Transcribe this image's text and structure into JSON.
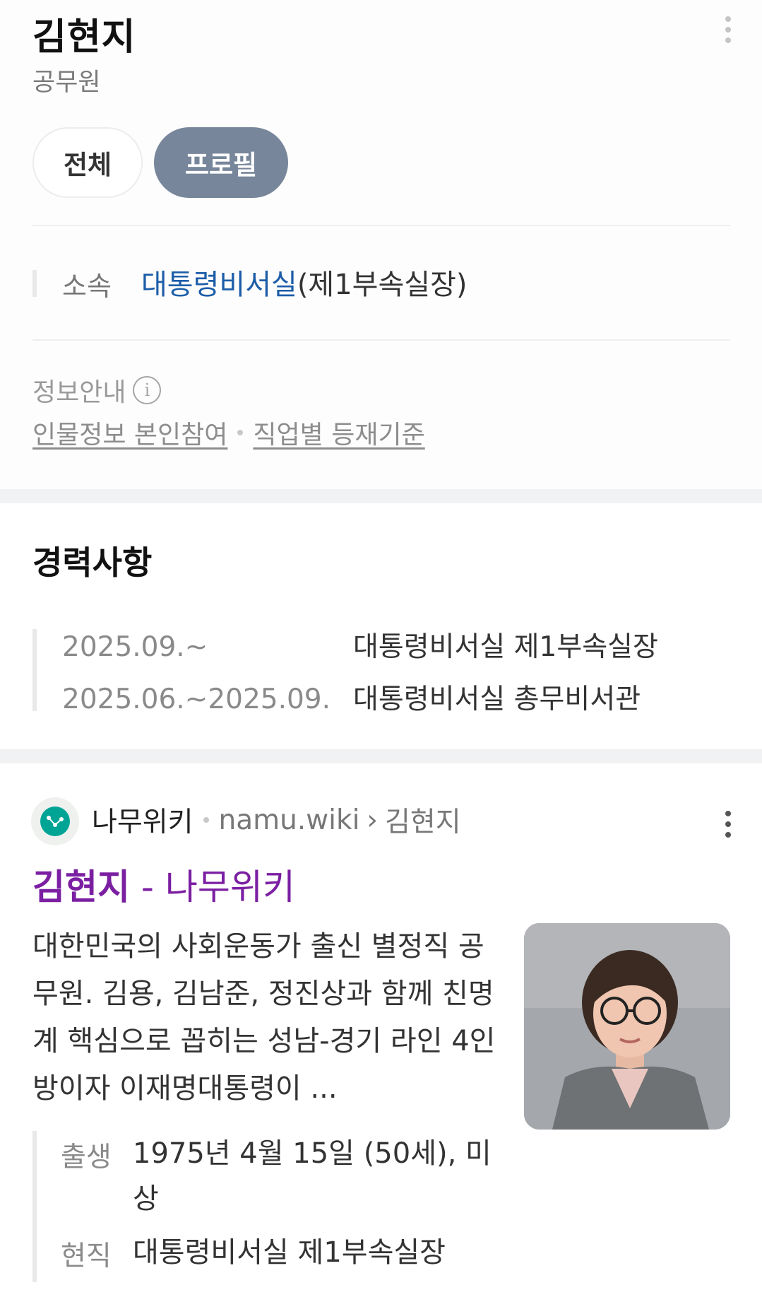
{
  "person": {
    "name": "김현지",
    "occupation": "공무원"
  },
  "tabs": [
    {
      "label": "전체",
      "selected": false
    },
    {
      "label": "프로필",
      "selected": true
    }
  ],
  "affiliation": {
    "label": "소속",
    "link_text": "대통령비서실",
    "suffix": "(제1부속실장)"
  },
  "info": {
    "title": "정보안내",
    "icon": "info-icon",
    "links": [
      "인물정보 본인참여",
      "직업별 등재기준"
    ]
  },
  "career": {
    "title": "경력사항",
    "rows": [
      {
        "period": "2025.09.~",
        "desc": "대통령비서실 제1부속실장"
      },
      {
        "period": "2025.06.~2025.09.",
        "desc": "대통령비서실 총무비서관"
      }
    ]
  },
  "result": {
    "site_name": "나무위키",
    "site_url": "namu.wiki",
    "breadcrumb_sep": "›",
    "breadcrumb": "김현지",
    "title_bold": "김현지",
    "title_rest": " - 나무위키",
    "snippet": "대한민국의 사회운동가 출신 별정직 공무원. 김용, 김남준, 정진상과 함께 친명계 핵심으로 꼽히는 성남-경기 라인 4인방이자 이재명대통령이 ...",
    "facts": [
      {
        "label": "출생",
        "value": "1975년 4월 15일 (50세), 미상"
      },
      {
        "label": "현직",
        "value": "대통령비서실 제1부속실장"
      }
    ]
  },
  "colors": {
    "accent_link": "#1d5da8",
    "visited_title": "#7b1fa2",
    "tab_selected_bg": "#77869a",
    "namu_green": "#00a495"
  }
}
